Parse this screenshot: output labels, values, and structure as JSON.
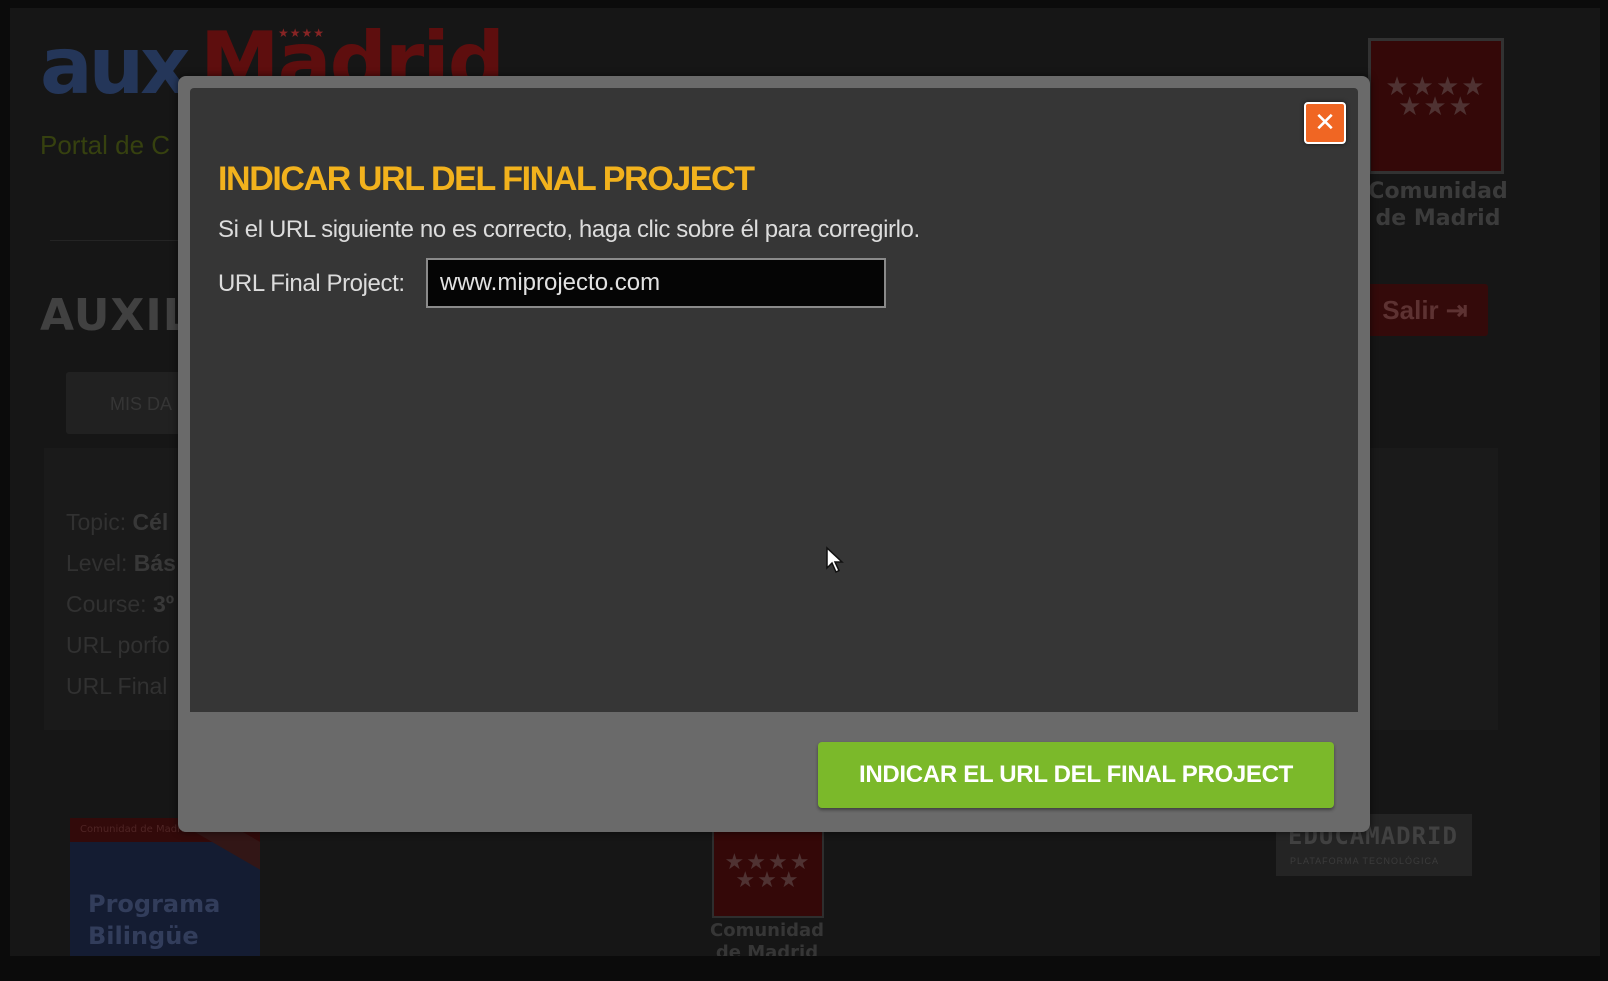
{
  "background": {
    "logo": {
      "part1": "aux",
      "part2": "Madrid",
      "subtitle": "Portal de C"
    },
    "page_title": "AUXIL",
    "tab_mis_datos": "MIS DA",
    "info_rows": [
      {
        "label": "Topic:",
        "value": "Cél"
      },
      {
        "label": "Level:",
        "value": "Bás"
      },
      {
        "label": "Course:",
        "value": "3º"
      },
      {
        "label": "URL porfo",
        "value": ""
      },
      {
        "label": "URL Final",
        "value": ""
      }
    ],
    "header_crest": {
      "line1": "Comunidad",
      "line2": "de Madrid"
    },
    "logout_label": "Salir",
    "footer": {
      "bilingue_bar": "Comunidad de Madrid",
      "bilingue_line1": "Programa",
      "bilingue_line2": "Bilingüe",
      "crest_line1": "Comunidad",
      "crest_line2": "de Madrid",
      "educa_title": "EDUCAMADRID",
      "educa_sub": "PLATAFORMA TECNOLÓGICA"
    }
  },
  "modal": {
    "close_label": "✕",
    "title": "INDICAR URL DEL FINAL PROJECT",
    "description": "Si el URL siguiente no es correcto, haga clic sobre él para corregirlo.",
    "url_label": "URL Final Project:",
    "url_value": "www.miprojecto.com",
    "submit_label": "INDICAR EL URL DEL FINAL PROJECT"
  },
  "colors": {
    "title_accent": "#f2b21d",
    "close_button": "#f06623",
    "submit_button": "#7bb92a"
  },
  "icons": {
    "close": "close-icon",
    "logout": "logout-icon",
    "cursor": "mouse-pointer-icon"
  }
}
